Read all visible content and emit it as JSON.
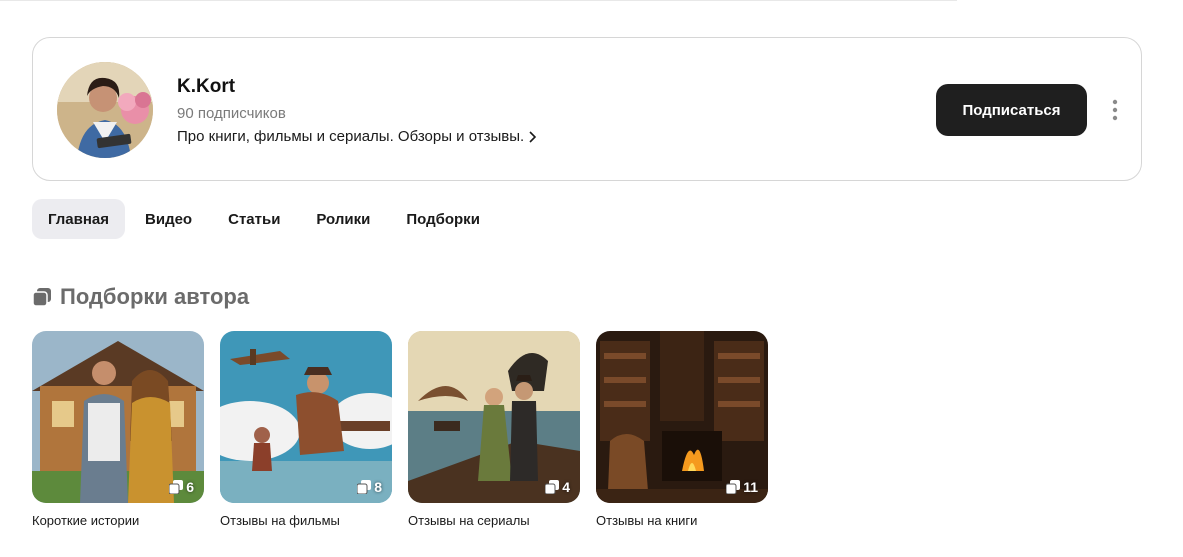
{
  "channel": {
    "name": "K.Kort",
    "subscribers": "90 подписчиков",
    "description": "Про книги, фильмы и сериалы. Обзоры и отзывы.",
    "subscribe_label": "Подписаться"
  },
  "tabs": [
    {
      "label": "Главная",
      "active": true
    },
    {
      "label": "Видео",
      "active": false
    },
    {
      "label": "Статьи",
      "active": false
    },
    {
      "label": "Ролики",
      "active": false
    },
    {
      "label": "Подборки",
      "active": false
    }
  ],
  "section": {
    "title": "Подборки автора"
  },
  "collections": [
    {
      "title": "Короткие истории",
      "count": "6"
    },
    {
      "title": "Отзывы на фильмы",
      "count": "8"
    },
    {
      "title": "Отзывы на сериалы",
      "count": "4"
    },
    {
      "title": "Отзывы на книги",
      "count": "11"
    }
  ],
  "colors": {
    "button_bg": "#1f1f1f",
    "active_tab_bg": "#ececf0",
    "card_border": "#d6d6d6"
  }
}
